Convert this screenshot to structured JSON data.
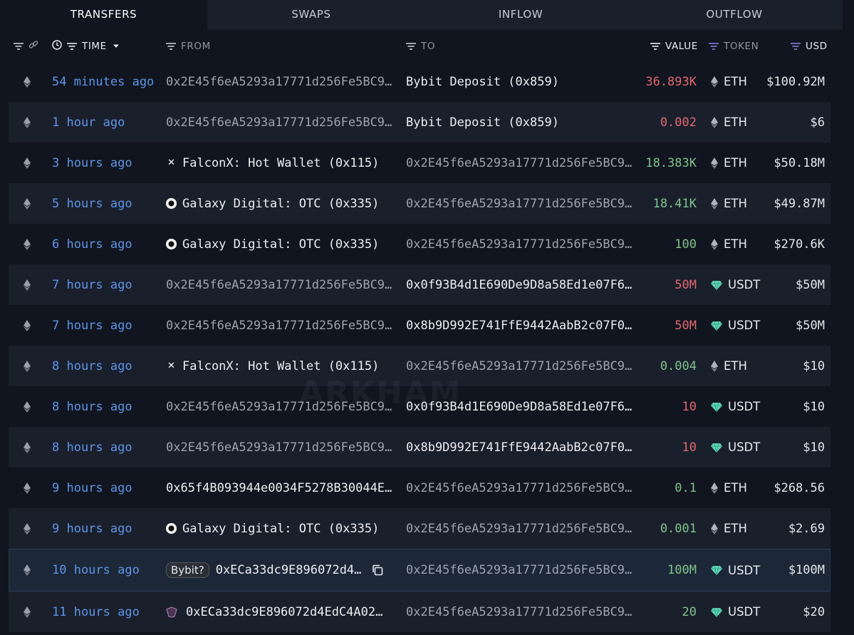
{
  "tabs": [
    {
      "label": "TRANSFERS",
      "active": true
    },
    {
      "label": "SWAPS",
      "active": false
    },
    {
      "label": "INFLOW",
      "active": false
    },
    {
      "label": "OUTFLOW",
      "active": false
    }
  ],
  "columns": {
    "time": "TIME",
    "from": "FROM",
    "to": "TO",
    "value": "VALUE",
    "token": "TOKEN",
    "usd": "USD"
  },
  "watermark": "ARKHAM",
  "colors": {
    "accent_time": "#5e95e6",
    "value_out": "#e0686e",
    "value_in": "#7fc48a",
    "usdt": "#5fd3b4"
  },
  "rows": [
    {
      "time": "54 minutes ago",
      "from": {
        "text": "0x2E45f6eA5293a17771d256Fe5BC9…",
        "type": "address"
      },
      "to": {
        "text": "Bybit Deposit (0x859)",
        "type": "entity-plain"
      },
      "value": "36.893K",
      "direction": "out",
      "token": "ETH",
      "usd": "$100.92M"
    },
    {
      "time": "1 hour ago",
      "from": {
        "text": "0x2E45f6eA5293a17771d256Fe5BC9…",
        "type": "address"
      },
      "to": {
        "text": "Bybit Deposit (0x859)",
        "type": "entity-plain"
      },
      "value": "0.002",
      "direction": "out",
      "token": "ETH",
      "usd": "$6"
    },
    {
      "time": "3 hours ago",
      "from": {
        "text": "FalconX: Hot Wallet (0x115)",
        "type": "entity",
        "icon": "falconx-icon"
      },
      "to": {
        "text": "0x2E45f6eA5293a17771d256Fe5BC9…",
        "type": "address"
      },
      "value": "18.383K",
      "direction": "in",
      "token": "ETH",
      "usd": "$50.18M"
    },
    {
      "time": "5 hours ago",
      "from": {
        "text": "Galaxy Digital: OTC (0x335)",
        "type": "entity",
        "icon": "galaxy-icon"
      },
      "to": {
        "text": "0x2E45f6eA5293a17771d256Fe5BC9…",
        "type": "address"
      },
      "value": "18.41K",
      "direction": "in",
      "token": "ETH",
      "usd": "$49.87M"
    },
    {
      "time": "6 hours ago",
      "from": {
        "text": "Galaxy Digital: OTC (0x335)",
        "type": "entity",
        "icon": "galaxy-icon"
      },
      "to": {
        "text": "0x2E45f6eA5293a17771d256Fe5BC9…",
        "type": "address"
      },
      "value": "100",
      "direction": "in",
      "token": "ETH",
      "usd": "$270.6K"
    },
    {
      "time": "7 hours ago",
      "from": {
        "text": "0x2E45f6eA5293a17771d256Fe5BC9…",
        "type": "address"
      },
      "to": {
        "text": "0x0f93B4d1E690De9D8a58Ed1e07F6…",
        "type": "address-bright"
      },
      "value": "50M",
      "direction": "out",
      "token": "USDT",
      "usd": "$50M"
    },
    {
      "time": "7 hours ago",
      "from": {
        "text": "0x2E45f6eA5293a17771d256Fe5BC9…",
        "type": "address"
      },
      "to": {
        "text": "0x8b9D992E741FfE9442AabB2c07F0…",
        "type": "address-bright"
      },
      "value": "50M",
      "direction": "out",
      "token": "USDT",
      "usd": "$50M"
    },
    {
      "time": "8 hours ago",
      "from": {
        "text": "FalconX: Hot Wallet (0x115)",
        "type": "entity",
        "icon": "falconx-icon"
      },
      "to": {
        "text": "0x2E45f6eA5293a17771d256Fe5BC9…",
        "type": "address"
      },
      "value": "0.004",
      "direction": "in",
      "token": "ETH",
      "usd": "$10"
    },
    {
      "time": "8 hours ago",
      "from": {
        "text": "0x2E45f6eA5293a17771d256Fe5BC9…",
        "type": "address"
      },
      "to": {
        "text": "0x0f93B4d1E690De9D8a58Ed1e07F6…",
        "type": "address-bright"
      },
      "value": "10",
      "direction": "out",
      "token": "USDT",
      "usd": "$10"
    },
    {
      "time": "8 hours ago",
      "from": {
        "text": "0x2E45f6eA5293a17771d256Fe5BC9…",
        "type": "address"
      },
      "to": {
        "text": "0x8b9D992E741FfE9442AabB2c07F0…",
        "type": "address-bright"
      },
      "value": "10",
      "direction": "out",
      "token": "USDT",
      "usd": "$10"
    },
    {
      "time": "9 hours ago",
      "from": {
        "text": "0x65f4B093944e0034F5278B30044E…",
        "type": "address-bright"
      },
      "to": {
        "text": "0x2E45f6eA5293a17771d256Fe5BC9…",
        "type": "address"
      },
      "value": "0.1",
      "direction": "in",
      "token": "ETH",
      "usd": "$268.56"
    },
    {
      "time": "9 hours ago",
      "from": {
        "text": "Galaxy Digital: OTC (0x335)",
        "type": "entity",
        "icon": "galaxy-icon"
      },
      "to": {
        "text": "0x2E45f6eA5293a17771d256Fe5BC9…",
        "type": "address"
      },
      "value": "0.001",
      "direction": "in",
      "token": "ETH",
      "usd": "$2.69"
    },
    {
      "time": "10 hours ago",
      "from": {
        "text": "0xECa33dc9E896072d4…",
        "type": "tagged",
        "tag": "Bybit?"
      },
      "to": {
        "text": "0x2E45f6eA5293a17771d256Fe5BC9…",
        "type": "address"
      },
      "value": "100M",
      "direction": "in",
      "token": "USDT",
      "usd": "$100M",
      "highlight": true
    },
    {
      "time": "11 hours ago",
      "from": {
        "text": "0xECa33dc9E896072d4EdC4A02…",
        "type": "shield"
      },
      "to": {
        "text": "0x2E45f6eA5293a17771d256Fe5BC9…",
        "type": "address"
      },
      "value": "20",
      "direction": "in",
      "token": "USDT",
      "usd": "$20"
    }
  ]
}
